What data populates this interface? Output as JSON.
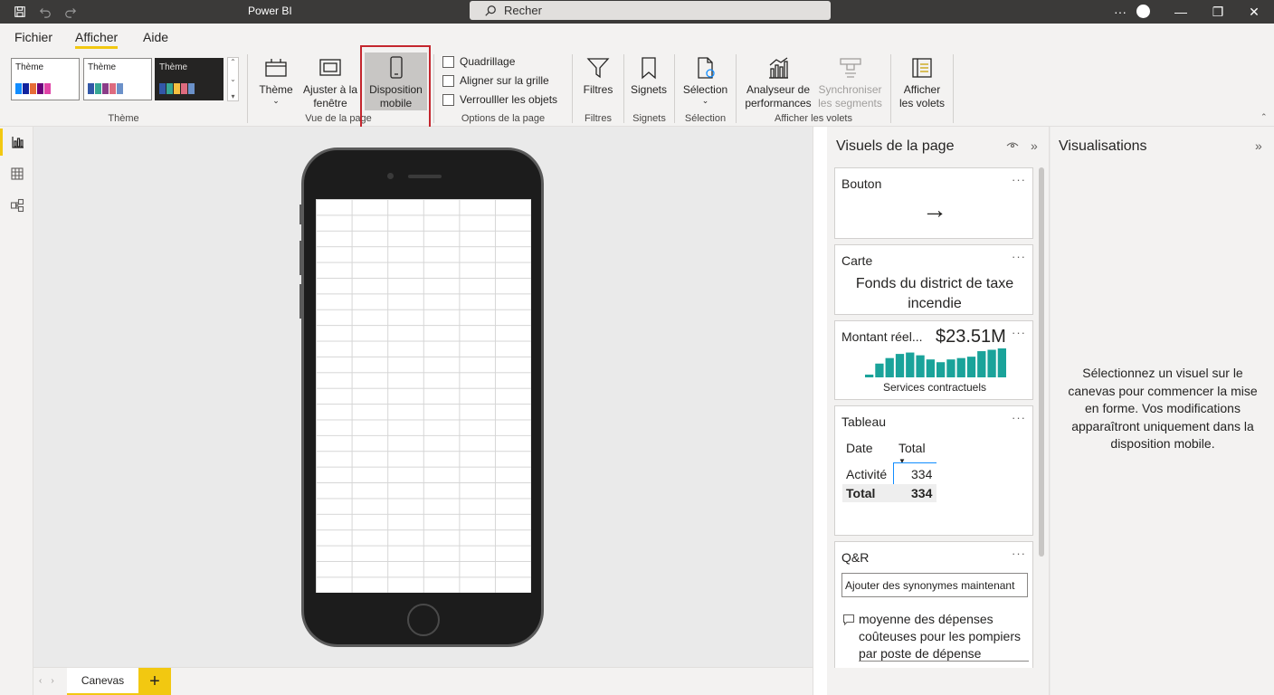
{
  "titlebar": {
    "app_title": "Power BI",
    "search_placeholder": "Recher",
    "more": "···",
    "minimize": "—",
    "restore": "❐",
    "close": "✕"
  },
  "menu": {
    "tabs": [
      "Fichier",
      "Afficher",
      "Aide"
    ],
    "active": "Afficher"
  },
  "ribbon": {
    "themes": [
      {
        "label": "Thème",
        "dark": false,
        "colors": [
          "#118dff",
          "#12239e",
          "#e66c37",
          "#6b007b",
          "#e044a7"
        ]
      },
      {
        "label": "Thème",
        "dark": false,
        "colors": [
          "#3257a8",
          "#37a794",
          "#8b3d88",
          "#dd6b7f",
          "#6b91c9"
        ]
      },
      {
        "label": "Thème",
        "dark": true,
        "colors": [
          "#3257a8",
          "#37a794",
          "#f5c040",
          "#dd6b7f",
          "#6b91c9"
        ]
      }
    ],
    "groups": {
      "theme": "Thème",
      "page_view": "Vue de la page",
      "page_options": "Options de la page",
      "filters": "Filtres",
      "bookmarks": "Signets",
      "selection": "Sélection",
      "show_panes": "Afficher les volets"
    },
    "buttons": {
      "theme": "Thème",
      "fit_line1": "Ajuster à la",
      "fit_line2": "fenêtre",
      "mobile_line1": "Disposition",
      "mobile_line2": "mobile",
      "filters": "Filtres",
      "bookmarks": "Signets",
      "selection": "Sélection",
      "perf_line1": "Analyseur de",
      "perf_line2": "performances",
      "sync_line1": "Synchroniser",
      "sync_line2": "les segments",
      "panes_line1": "Afficher",
      "panes_line2": "les volets"
    },
    "checkboxes": [
      "Quadrillage",
      "Aligner sur la grille",
      "Verroulller les objets"
    ]
  },
  "pagebar": {
    "tab": "Canevas",
    "add": "+"
  },
  "page_visuals": {
    "title": "Visuels de la page",
    "cards": {
      "button": {
        "title": "Bouton",
        "arrow": "→"
      },
      "card": {
        "title": "Carte",
        "line1": "Fonds du district de taxe",
        "line2": "incendie"
      },
      "kpi": {
        "title": "Montant réel...",
        "value": "$23.51M",
        "subtitle": "Services contractuels",
        "bars": [
          2,
          10,
          14,
          17,
          18,
          16,
          13,
          11,
          13,
          14,
          15,
          19,
          20,
          21
        ]
      },
      "table": {
        "title": "Tableau",
        "col1": "Date",
        "col2": "Total",
        "row1_label": "Activité",
        "row1_value": "334",
        "total_label": "Total",
        "total_value": "334"
      },
      "qa": {
        "title": "Q&R",
        "input": "Ajouter des synonymes maintenant",
        "suggest_line1": "moyenne des dépenses",
        "suggest_line2": "coûteuses pour les pompiers",
        "suggest_line3": "par poste de dépense"
      }
    }
  },
  "visualizations": {
    "title": "Visualisations",
    "message": "Sélectionnez un visuel sur le canevas pour commencer la mise en forme. Vos modifications apparaîtront uniquement dans la disposition mobile."
  },
  "colors": {
    "accent": "#f2c811",
    "highlight": "#c4262e",
    "kpi_bar": "#1aa39a"
  }
}
